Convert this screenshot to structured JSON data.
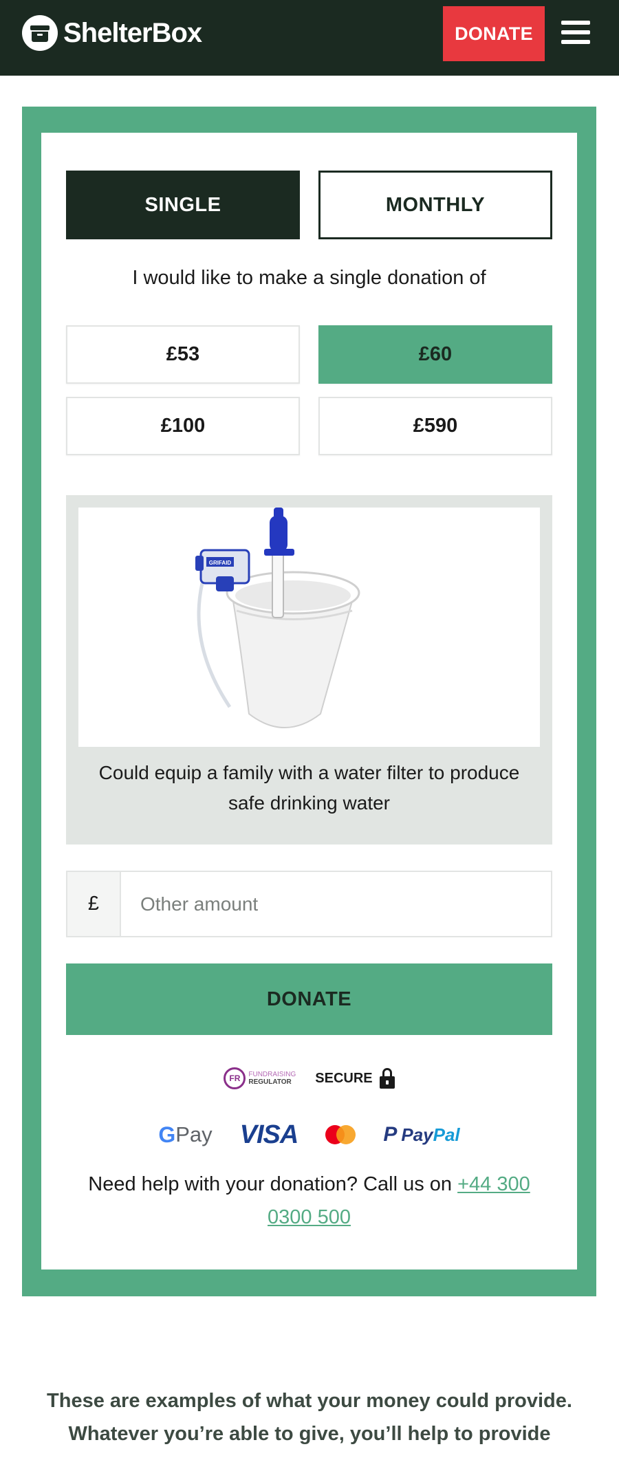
{
  "header": {
    "logo_text": "ShelterBox",
    "donate_label": "DONATE"
  },
  "frequency": {
    "single_label": "SINGLE",
    "monthly_label": "MONTHLY",
    "selected": "SINGLE"
  },
  "intro_text": "I would like to make a single donation of",
  "amounts": [
    {
      "label": "£53",
      "selected": false
    },
    {
      "label": "£60",
      "selected": true
    },
    {
      "label": "£100",
      "selected": false
    },
    {
      "label": "£590",
      "selected": false
    }
  ],
  "impact": {
    "image_label": "GRIFAID",
    "description": "Could equip a family with a water filter to produce safe drinking water"
  },
  "other_amount": {
    "currency_symbol": "£",
    "placeholder": "Other amount",
    "value": ""
  },
  "donate_button_label": "DONATE",
  "trust": {
    "fr_abbrev": "FR",
    "fr_line1": "FUNDRAISING",
    "fr_line2": "REGULATOR",
    "secure_label": "SECURE"
  },
  "payments": {
    "gpay_g": "G",
    "gpay_pay": "Pay",
    "visa": "VISA",
    "paypal_pay": "Pay",
    "paypal_pal": "Pal"
  },
  "help": {
    "text": "Need help with your donation? Call us on ",
    "phone": "+44 300 0300 500"
  },
  "bottom_text": "These are examples of what your money could provide. Whatever you’re able to give, you’ll help to provide",
  "colors": {
    "header_bg": "#1b2a21",
    "accent_green": "#54ab84",
    "donate_red": "#e8393f",
    "impact_bg": "#e1e5e2"
  }
}
